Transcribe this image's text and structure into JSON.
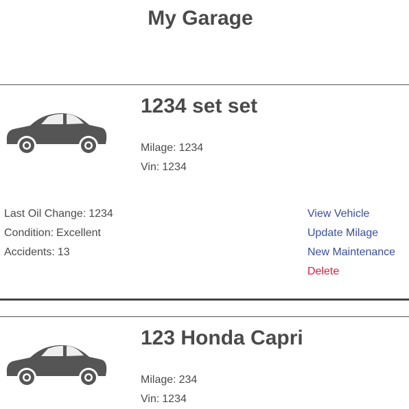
{
  "page": {
    "title": "My Garage"
  },
  "vehicles": [
    {
      "name": "1234 set set",
      "milage_label": "Milage:",
      "milage": "1234",
      "vin_label": "Vin:",
      "vin": "1234",
      "oil_label": "Last Oil Change:",
      "oil": "1234",
      "condition_label": "Condition:",
      "condition": "Excellent",
      "accidents_label": "Accidents:",
      "accidents": "13",
      "actions": {
        "view": "View Vehicle",
        "update": "Update Milage",
        "maintenance": "New Maintenance",
        "delete": "Delete"
      }
    },
    {
      "name": "123 Honda Capri",
      "milage_label": "Milage:",
      "milage": "234",
      "vin_label": "Vin:",
      "vin": "1234"
    }
  ],
  "icons": {
    "car": "car-icon"
  },
  "colors": {
    "text": "#4a4a4a",
    "link": "#3a4e9c",
    "delete": "#e8173f",
    "car": "#555555"
  }
}
